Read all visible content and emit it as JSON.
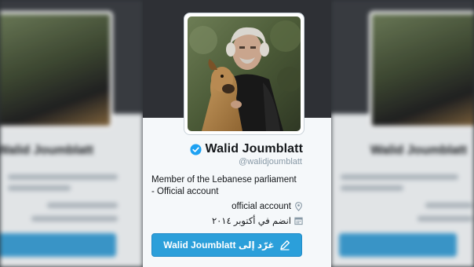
{
  "profile": {
    "name": "Walid Joumblatt",
    "handle": "@walidjoumblatt",
    "bio": "Member of the Lebanese parliament - Official account",
    "location": "official account",
    "joined": "انضم في أكتوبر ٢٠١٤",
    "verified": true
  },
  "actions": {
    "tweet_to_label": "غرّد إلى Walid Joumblatt"
  },
  "colors": {
    "accent": "#2b9fda",
    "verified_badge": "#1da1f2",
    "banner": "#2e3035",
    "card_bg": "#f5f8fa",
    "muted_text": "#8899a6"
  },
  "icons": [
    "verified-badge-icon",
    "location-pin-icon",
    "calendar-icon",
    "compose-tweet-icon"
  ]
}
